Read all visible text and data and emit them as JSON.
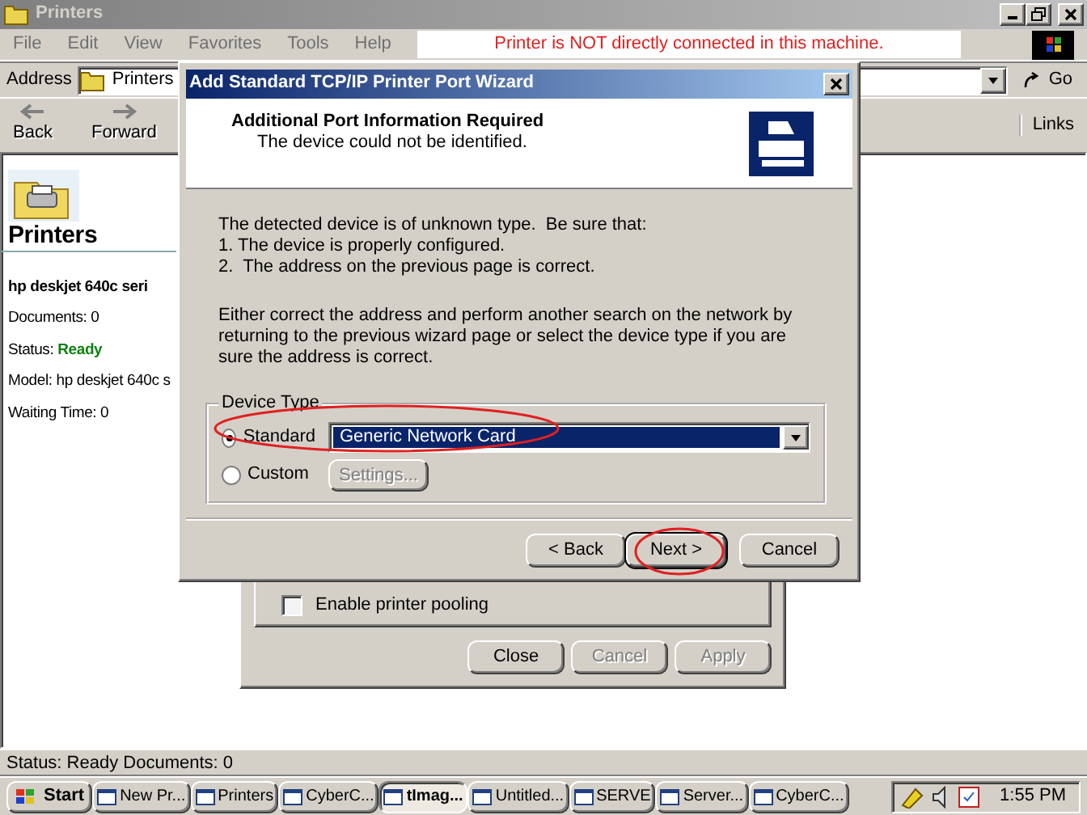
{
  "window": {
    "title": "Printers"
  },
  "menu": [
    "File",
    "Edit",
    "View",
    "Favorites",
    "Tools",
    "Help"
  ],
  "annotation": {
    "text": "Printer is NOT directly connected in this machine."
  },
  "address_bar": {
    "label": "Address",
    "value": "Printers",
    "go": "Go"
  },
  "toolbar": {
    "buttons": [
      {
        "label": "Back",
        "disabled": true
      },
      {
        "label": "Forward",
        "disabled": true
      }
    ],
    "links": "Links"
  },
  "left_pane": {
    "title": "Printers",
    "printer_name": "hp deskjet 640c seri",
    "details": [
      {
        "label": "Documents:",
        "value": "0",
        "kind": "plain"
      },
      {
        "label": "Status:",
        "value": "Ready",
        "kind": "status"
      },
      {
        "label": "Model:",
        "value": "hp deskjet 640c s",
        "kind": "plain"
      },
      {
        "label": "Waiting Time:",
        "value": "0",
        "kind": "plain"
      }
    ]
  },
  "properties_dialog": {
    "checkbox": {
      "label": "Enable printer pooling",
      "checked": false
    },
    "buttons": [
      {
        "label": "Close",
        "disabled": false
      },
      {
        "label": "Cancel",
        "disabled": true
      },
      {
        "label": "Apply",
        "disabled": true
      }
    ]
  },
  "wizard": {
    "title": "Add Standard TCP/IP Printer Port Wizard",
    "heading": "Additional Port Information Required",
    "subheading": "The device could not be identified.",
    "lines": [
      "The detected device is of unknown type.  Be sure that:",
      "1. The device is properly configured.",
      "2.  The address on the previous page is correct."
    ],
    "paragraph": "Either correct the address and perform another search on the network by returning to the previous wizard page or select the device type if you are sure the address is correct.",
    "device_type": {
      "label": "Device Type",
      "options": [
        {
          "label": "Standard",
          "selected": true
        },
        {
          "label": "Custom",
          "selected": false
        }
      ],
      "dropdown": "Generic Network Card",
      "settings": {
        "label": "Settings...",
        "disabled": true
      }
    },
    "buttons": [
      {
        "label": "< Back",
        "default": false
      },
      {
        "label": "Next >",
        "default": true
      },
      {
        "label": "Cancel",
        "default": false
      }
    ]
  },
  "status_bar": {
    "text": "Status: Ready Documents: 0"
  },
  "taskbar": {
    "start": "Start",
    "items": [
      {
        "label": "New Pr...",
        "selected": false
      },
      {
        "label": "Printers",
        "selected": false
      },
      {
        "label": "CyberC...",
        "selected": false
      },
      {
        "label": "tImag...",
        "selected": true
      },
      {
        "label": "Untitled...",
        "selected": false
      },
      {
        "label": "SERVE",
        "selected": false
      },
      {
        "label": "Server...",
        "selected": false
      },
      {
        "label": "CyberC...",
        "selected": false
      }
    ],
    "clock": "1:55 PM"
  }
}
